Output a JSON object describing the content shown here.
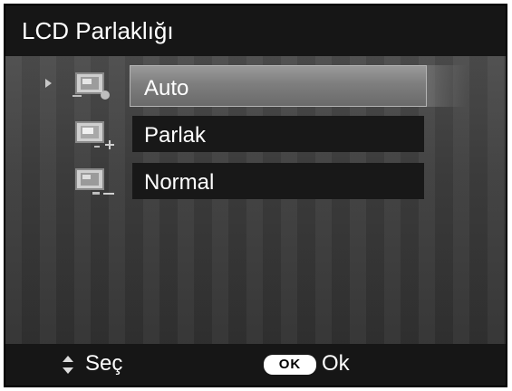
{
  "header": {
    "title": "LCD Parlaklığı"
  },
  "menu": {
    "selected_index": 0,
    "items": [
      {
        "label": "Auto",
        "icon": "lcd-brightness-auto-icon"
      },
      {
        "label": "Parlak",
        "icon": "lcd-brightness-bright-icon"
      },
      {
        "label": "Normal",
        "icon": "lcd-brightness-normal-icon"
      }
    ]
  },
  "footer": {
    "select_icon": "up-down-arrows-icon",
    "select_label": "Seç",
    "ok_badge": "OK",
    "ok_label": "Ok"
  },
  "colors": {
    "header_bg": "#161616",
    "selected_row": "#8a8a8a",
    "row_bg": "#181818",
    "text": "#ffffff"
  }
}
